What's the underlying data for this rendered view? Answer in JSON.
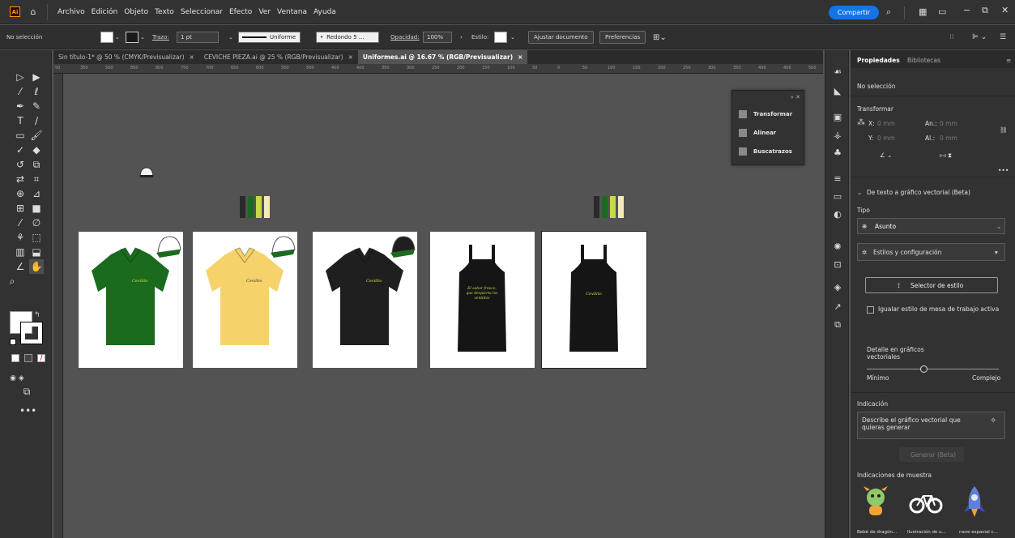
{
  "menubar": {
    "logo": "Ai",
    "items": [
      "Archivo",
      "Edición",
      "Objeto",
      "Texto",
      "Seleccionar",
      "Efecto",
      "Ver",
      "Ventana",
      "Ayuda"
    ],
    "share_label": "Compartir"
  },
  "controlbar": {
    "selection_label": "No selección",
    "stroke_label": "Trazo:",
    "stroke_value": "1 pt",
    "stroke_style": "Uniforme",
    "brush": "Redondo 5 ...",
    "opacity_label": "Opacidad:",
    "opacity_value": "100%",
    "style_label": "Estilo:",
    "adjust_doc_button": "Ajustar documento",
    "prefs_button": "Preferencias"
  },
  "tabs": [
    {
      "label": "Sin título-1* @ 50 % (CMYK/Previsualizar)",
      "close": "×"
    },
    {
      "label": "CEVICHE PIEZA.ai @ 25 % (RGB/Previsualizar)",
      "close": "×"
    },
    {
      "label": "Uniformes.ai @ 16.67 % (RGB/Previsualizar)",
      "close": "×"
    }
  ],
  "ruler_ticks": [
    "50",
    "350",
    "500",
    "850",
    "800",
    "750",
    "700",
    "650",
    "600",
    "550",
    "500",
    "450",
    "400",
    "350",
    "300",
    "250",
    "200",
    "150",
    "100",
    "50",
    "0",
    "50",
    "100",
    "150",
    "200",
    "250",
    "300",
    "350",
    "400",
    "450",
    "500"
  ],
  "artboards": [
    {
      "garment": "polo",
      "color": "#1a6b1e",
      "logo": "Cevilito",
      "cap_color": "#ffffff",
      "text_color": "#d8e040"
    },
    {
      "garment": "polo",
      "color": "#f5d36a",
      "logo": "Cevilito",
      "cap_color": "#ffffff",
      "text_color": "#2b2b2b"
    },
    {
      "garment": "polo",
      "color": "#1f1f1f",
      "logo": "Cevilito",
      "cap_color": "#1f1f1f",
      "text_color": "#d8e040"
    },
    {
      "garment": "apron",
      "color": "#151515",
      "logo": "El sabor fresco, que despierta los sentidos",
      "text_color": "#c6d84a"
    },
    {
      "garment": "apron",
      "color": "#151515",
      "logo": "Cevilito",
      "text_color": "#d8e040"
    }
  ],
  "swatches": [
    "#2a2a2a",
    "#1a6b1e",
    "#c8d84a",
    "#f5e9b8"
  ],
  "float_panel": {
    "items": [
      "Transformar",
      "Alinear",
      "Buscatrazos"
    ]
  },
  "right_panel": {
    "tabs": [
      "Propiedades",
      "Bibliotecas"
    ],
    "no_selection": "No selección",
    "transform_title": "Transformar",
    "x_label": "X:",
    "y_label": "Y:",
    "w_label": "An.:",
    "h_label": "Al.:",
    "x_value": "0 mm",
    "y_value": "0 mm",
    "w_value": "0 mm",
    "h_value": "0 mm",
    "beta_title": "De texto a gráfico vectorial (Beta)",
    "type_label": "Tipo",
    "type_value": "Asunto",
    "styles_label": "Estilos y configuración",
    "style_picker": "Selector de estilo",
    "match_style": "Igualar estilo de mesa de trabajo activa",
    "detail_label": "Detalle en gráficos vectoriales",
    "min_label": "Mínimo",
    "max_label": "Complejo",
    "prompt_title": "Indicación",
    "prompt_placeholder": "Describe el gráfico vectorial que quieras generar",
    "generate_button": "Generar (Beta)",
    "samples_title": "Indicaciones de muestra",
    "samples": [
      "Bebé de dragón...",
      "Ilustración de u...",
      "nave espacial c..."
    ]
  }
}
